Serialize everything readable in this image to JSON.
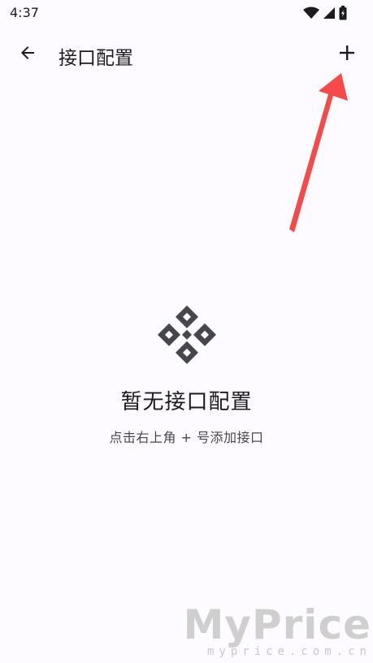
{
  "status_bar": {
    "time": "4:37",
    "icons": [
      "wifi-icon",
      "signal-icon",
      "battery-icon"
    ]
  },
  "app_bar": {
    "title": "接口配置",
    "back_icon": "arrow-left-icon",
    "add_icon": "plus-icon"
  },
  "empty_state": {
    "icon": "diamond-logo-icon",
    "title": "暂无接口配置",
    "hint": "点击右上角 + 号添加接口"
  },
  "annotation": {
    "arrow_color": "#f44a4a"
  },
  "watermark": {
    "logo": "MyPrice",
    "url": "myprice.com.cn"
  },
  "colors": {
    "background": "#fdfbff",
    "text": "#1c1b1f",
    "icon": "#45474d"
  }
}
